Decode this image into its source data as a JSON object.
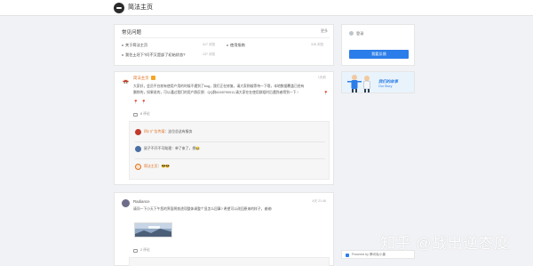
{
  "header": {
    "site_name": "简法主页"
  },
  "faq": {
    "title": "常见问题",
    "more": "更多",
    "questions": [
      {
        "text": "关于简法主页",
        "count": "417 浏览"
      },
      {
        "text": "使用指南",
        "count": "316 浏览"
      },
      {
        "text": "我住土坯下?问不又是部了初始状态?",
        "count": "137 浏览"
      }
    ]
  },
  "post1": {
    "author": "简法主页",
    "time": "1天前",
    "text_lines": [
      "大家好，会员平台前有使用户用的时候不遇到了bug，我们正在修复，请大家稍候等待一下哦，本地数据覆盖已经有",
      "删除的，如果说的，可以通过我们的用户群反馈：QQ群6245790011,请大家在在使用群组时后遇到者得到一下 !"
    ],
    "reply_count": "8 评论",
    "comments": [
      {
        "name": "四川广告传媒",
        "text": "：这位总这有服务"
      },
      {
        "name": "",
        "text": "鼠子不开不可助理：单了来了，想😂"
      },
      {
        "name": "简法主页",
        "text": "：😎😎"
      }
    ]
  },
  "post2": {
    "author": "Radiance",
    "time": "4天 21:46",
    "text": "请问一下小天下午您的界面将前途项整体调整个显怎么回事? 希望可以改回原来的样子，谢谢!",
    "reply_count": "2 评论"
  },
  "sidebar": {
    "login": "登录",
    "ask_button": "我要反馈",
    "banner_title": "我们的故事",
    "banner_sub": "Our Story",
    "powered_by": "Powered by 腾讯兔小巢"
  },
  "watermark": "知乎 @战出逆态度",
  "colors": {
    "accent": "#2b7de9",
    "author": "#e07020"
  }
}
